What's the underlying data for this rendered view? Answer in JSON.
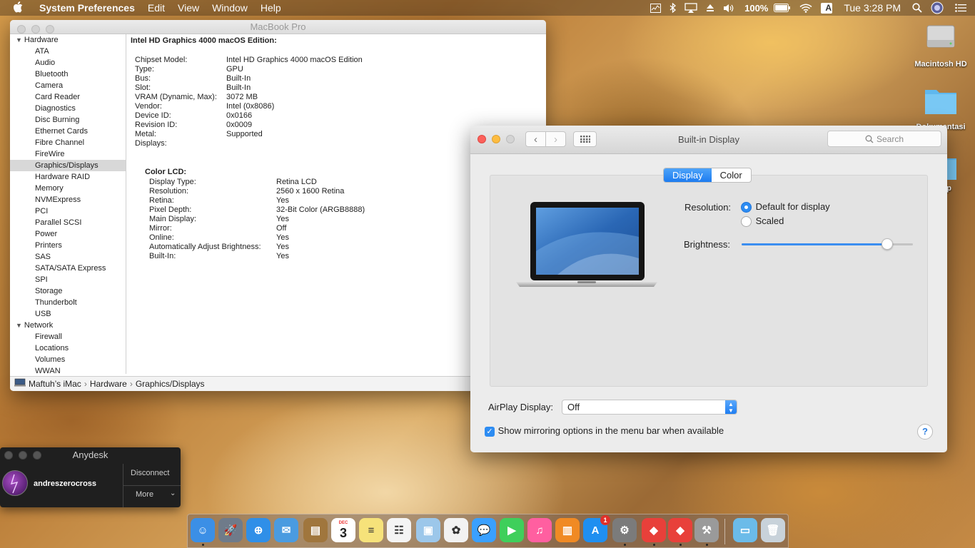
{
  "menubar": {
    "apple": "",
    "app_name": "System Preferences",
    "menus": [
      "Edit",
      "View",
      "Window",
      "Help"
    ],
    "battery": "100%",
    "input_source": "A",
    "clock": "Tue 3:28 PM"
  },
  "desktop": {
    "icons": [
      {
        "label": "Macintosh HD"
      },
      {
        "label": "Dokumentasi"
      },
      {
        "label": "p"
      }
    ]
  },
  "sysinfo": {
    "title": "MacBook Pro",
    "sidebar": {
      "hardware_label": "Hardware",
      "hardware_items": [
        "ATA",
        "Audio",
        "Bluetooth",
        "Camera",
        "Card Reader",
        "Diagnostics",
        "Disc Burning",
        "Ethernet Cards",
        "Fibre Channel",
        "FireWire",
        "Graphics/Displays",
        "Hardware RAID",
        "Memory",
        "NVMExpress",
        "PCI",
        "Parallel SCSI",
        "Power",
        "Printers",
        "SAS",
        "SATA/SATA Express",
        "SPI",
        "Storage",
        "Thunderbolt",
        "USB"
      ],
      "selected_item": "Graphics/Displays",
      "network_label": "Network",
      "network_items": [
        "Firewall",
        "Locations",
        "Volumes",
        "WWAN"
      ]
    },
    "heading": "Intel HD Graphics 4000 macOS Edition:",
    "properties": [
      {
        "k": "Chipset Model:",
        "v": "Intel HD Graphics 4000 macOS Edition"
      },
      {
        "k": "Type:",
        "v": "GPU"
      },
      {
        "k": "Bus:",
        "v": "Built-In"
      },
      {
        "k": "Slot:",
        "v": "Built-In"
      },
      {
        "k": "VRAM (Dynamic, Max):",
        "v": "3072 MB"
      },
      {
        "k": "Vendor:",
        "v": "Intel (0x8086)"
      },
      {
        "k": "Device ID:",
        "v": "0x0166"
      },
      {
        "k": "Revision ID:",
        "v": "0x0009"
      },
      {
        "k": "Metal:",
        "v": "Supported"
      },
      {
        "k": "Displays:",
        "v": ""
      }
    ],
    "display_name": "Color LCD:",
    "display_props": [
      {
        "k": "Display Type:",
        "v": "Retina LCD"
      },
      {
        "k": "Resolution:",
        "v": "2560 x 1600 Retina"
      },
      {
        "k": "Retina:",
        "v": "Yes"
      },
      {
        "k": "Pixel Depth:",
        "v": "32-Bit Color (ARGB8888)"
      },
      {
        "k": "Main Display:",
        "v": "Yes"
      },
      {
        "k": "Mirror:",
        "v": "Off"
      },
      {
        "k": "Online:",
        "v": "Yes"
      },
      {
        "k": "Automatically Adjust Brightness:",
        "v": "Yes"
      },
      {
        "k": "Built-In:",
        "v": "Yes"
      }
    ],
    "path": [
      "Maftuh’s iMac",
      "Hardware",
      "Graphics/Displays"
    ]
  },
  "prefs": {
    "title": "Built-in Display",
    "search_placeholder": "Search",
    "tabs": [
      "Display",
      "Color"
    ],
    "active_tab": "Display",
    "resolution_label": "Resolution:",
    "resolution_options": [
      "Default for display",
      "Scaled"
    ],
    "resolution_selected": "Default for display",
    "brightness_label": "Brightness:",
    "brightness_level": 0.85,
    "airplay_label": "AirPlay Display:",
    "airplay_value": "Off",
    "mirroring_label": "Show mirroring options in the menu bar when available",
    "mirroring_checked": true,
    "help": "?"
  },
  "anydesk": {
    "title": "Anydesk",
    "user": "andreszerocross",
    "disconnect": "Disconnect",
    "more": "More"
  },
  "dock": {
    "apps": [
      "Finder",
      "Launchpad",
      "Safari",
      "Mail",
      "Contacts",
      "Calendar",
      "Notes",
      "Reminders",
      "Preview",
      "Photos",
      "Messages",
      "FaceTime",
      "iTunes",
      "iBooks",
      "App Store",
      "System Preferences",
      "AnyDesk",
      "AnyDesk",
      "Utility",
      "Documents",
      "Trash"
    ],
    "calendar_month": "DEC",
    "calendar_day": "3",
    "appstore_badge": "1"
  }
}
